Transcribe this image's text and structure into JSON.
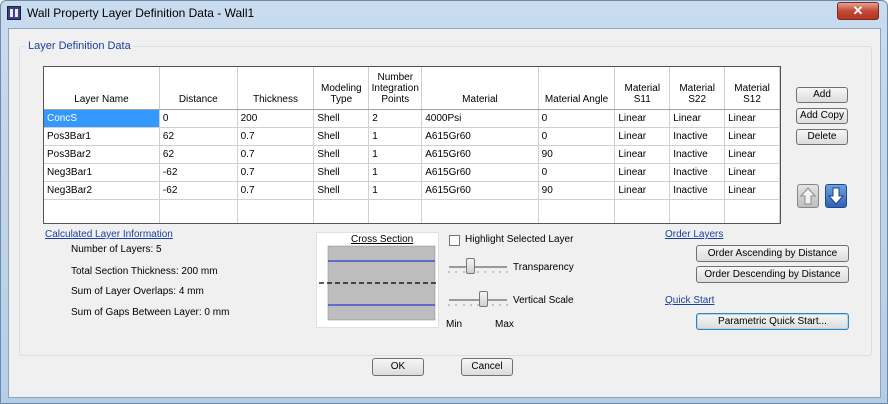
{
  "window": {
    "title": "Wall Property Layer Definition Data - Wall1",
    "close_glyph": "✕"
  },
  "group": {
    "title": "Layer Definition Data"
  },
  "table": {
    "columns": [
      "Layer Name",
      "Distance",
      "Thickness",
      "Modeling Type",
      "Number Integration Points",
      "Material",
      "Material Angle",
      "Material S11",
      "Material S22",
      "Material S12"
    ],
    "rows": [
      [
        "ConcS",
        "0",
        "200",
        "Shell",
        "2",
        "4000Psi",
        "0",
        "Linear",
        "Linear",
        "Linear"
      ],
      [
        "Pos3Bar1",
        "62",
        "0.7",
        "Shell",
        "1",
        "A615Gr60",
        "0",
        "Linear",
        "Inactive",
        "Linear"
      ],
      [
        "Pos3Bar2",
        "62",
        "0.7",
        "Shell",
        "1",
        "A615Gr60",
        "90",
        "Linear",
        "Inactive",
        "Linear"
      ],
      [
        "Neg3Bar1",
        "-62",
        "0.7",
        "Shell",
        "1",
        "A615Gr60",
        "0",
        "Linear",
        "Inactive",
        "Linear"
      ],
      [
        "Neg3Bar2",
        "-62",
        "0.7",
        "Shell",
        "1",
        "A615Gr60",
        "90",
        "Linear",
        "Inactive",
        "Linear"
      ]
    ],
    "selected_row": 0
  },
  "side_buttons": {
    "add": "Add",
    "add_copy": "Add Copy",
    "delete": "Delete"
  },
  "calc": {
    "title": "Calculated Layer Information",
    "num_layers": "Number of Layers:  5",
    "total_thickness": "Total Section Thickness:  200 mm",
    "overlaps": "Sum of Layer Overlaps:  4 mm",
    "gaps": "Sum of Gaps Between Layer:  0 mm"
  },
  "cross_section": {
    "title": "Cross Section"
  },
  "highlight": {
    "label": "Highlight Selected Layer",
    "checked": false
  },
  "transparency": {
    "label": "Transparency",
    "level": 0.35
  },
  "vertical_scale": {
    "label": "Vertical Scale",
    "level": 0.6
  },
  "scale_labels": {
    "min": "Min",
    "max": "Max"
  },
  "order": {
    "title": "Order Layers",
    "ascending": "Order Ascending by Distance",
    "descending": "Order Descending by Distance"
  },
  "quick": {
    "title": "Quick Start",
    "button": "Parametric Quick Start..."
  },
  "footer": {
    "ok": "OK",
    "cancel": "Cancel"
  },
  "colors": {
    "accent": "#1b3fa0",
    "selection": "#3399ff",
    "rebar_line": "#2a3fd0",
    "concrete": "#bdbdbd"
  },
  "icons": {
    "up": "arrow-up-icon",
    "down": "arrow-down-icon"
  }
}
